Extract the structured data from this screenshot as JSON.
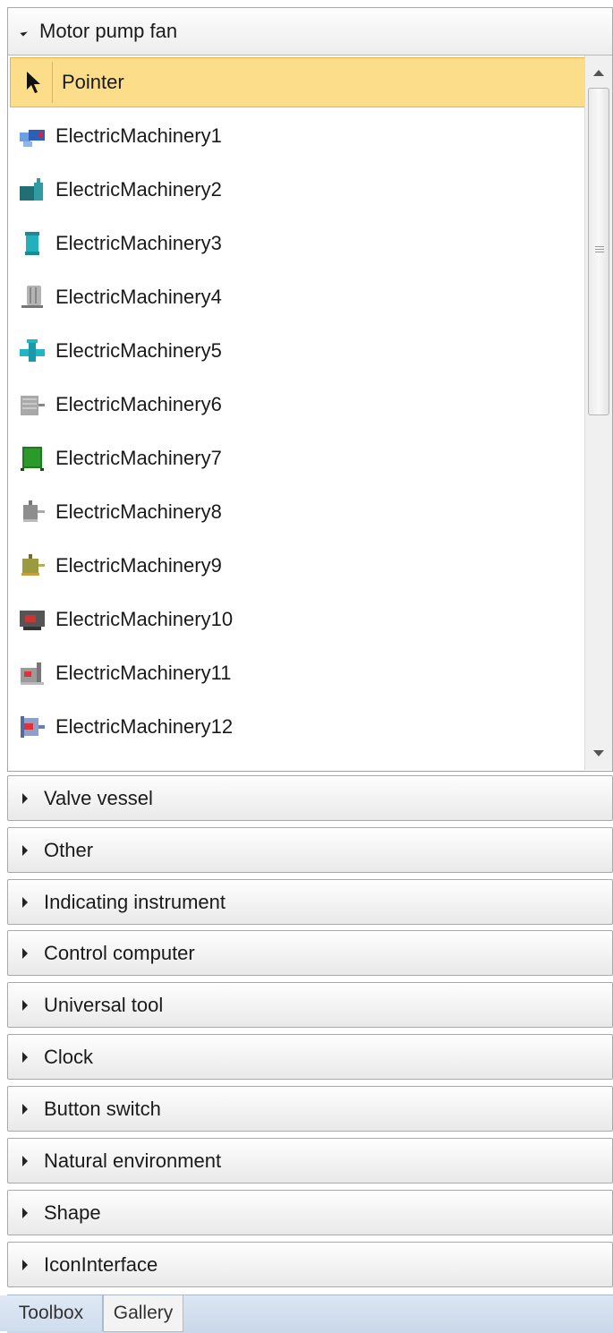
{
  "toolbox": {
    "open_group": {
      "title": "Motor pump fan",
      "icon": "triangle-down-icon"
    },
    "items": [
      {
        "label": "Pointer",
        "icon": "pointer-arrow-icon",
        "selected": true
      },
      {
        "label": "ElectricMachinery1",
        "icon": "blue-motor-icon",
        "color": "#3f7fd1"
      },
      {
        "label": "ElectricMachinery2",
        "icon": "teal-pump-icon",
        "color": "#2f8f95"
      },
      {
        "label": "ElectricMachinery3",
        "icon": "cyan-tank-icon",
        "color": "#20a6b3"
      },
      {
        "label": "ElectricMachinery4",
        "icon": "gray-cylinder-icon",
        "color": "#9a9a9a"
      },
      {
        "label": "ElectricMachinery5",
        "icon": "cyan-cross-valve-icon",
        "color": "#22b6c4"
      },
      {
        "label": "ElectricMachinery6",
        "icon": "gray-finned-motor-icon",
        "color": "#a5a5a5"
      },
      {
        "label": "ElectricMachinery7",
        "icon": "green-cabinet-icon",
        "color": "#1e7a1e"
      },
      {
        "label": "ElectricMachinery8",
        "icon": "gray-motor-icon",
        "color": "#8e8e8e"
      },
      {
        "label": "ElectricMachinery9",
        "icon": "olive-motor-icon",
        "color": "#9a9a40"
      },
      {
        "label": "ElectricMachinery10",
        "icon": "dark-red-motor-icon",
        "color": "#555555"
      },
      {
        "label": "ElectricMachinery11",
        "icon": "red-gray-pump-icon",
        "color": "#999999"
      },
      {
        "label": "ElectricMachinery12",
        "icon": "blue-red-motor-icon",
        "color": "#6b7fb3"
      }
    ],
    "groups": [
      "Valve vessel",
      "Other",
      "Indicating instrument",
      "Control computer",
      "Universal tool",
      "Clock",
      "Button switch",
      "Natural environment",
      "Shape",
      "IconInterface"
    ],
    "tabs": [
      "Toolbox",
      "Gallery"
    ]
  },
  "colors": {
    "selection_fill": "#fbdd8a",
    "selection_border": "#e6b64c",
    "tab_bar": "#c9d8ea"
  }
}
